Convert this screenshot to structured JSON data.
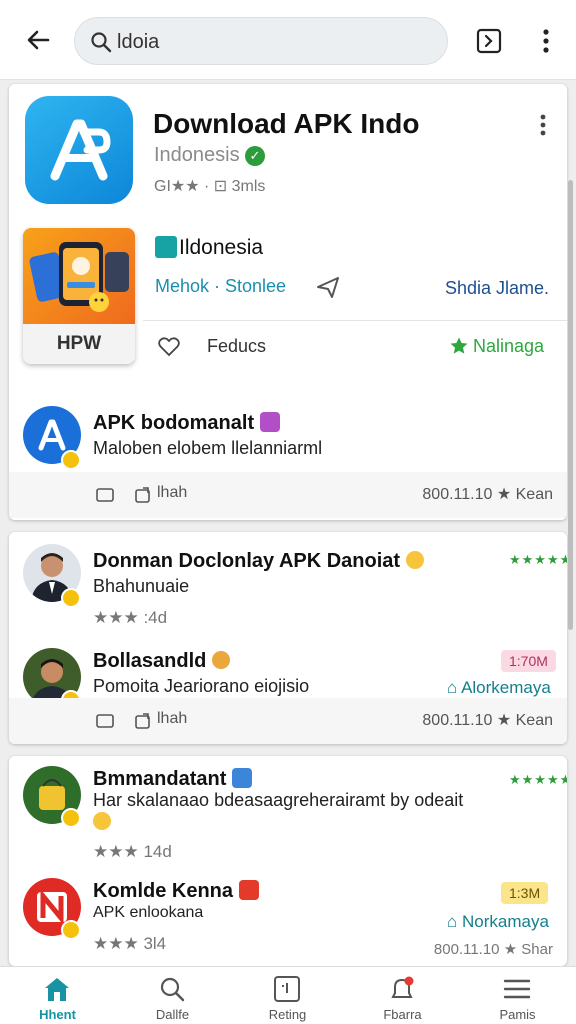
{
  "search": {
    "query": "ldoia"
  },
  "app": {
    "title": "Download APK Indo",
    "region": "Indonesis",
    "meta": "GI★★ · ⊡ 3mls"
  },
  "featured": {
    "tile_label": "HPW",
    "country": "Ildonesia",
    "links": "Mehok · Stonlee",
    "right_text": "Shdia Jlame.",
    "action_label": "Feducs",
    "star_label": "Nalinaga"
  },
  "posts": [
    {
      "title": "APK bodomanalt",
      "subtitle": "Maloben elobem llelanniarml",
      "footer_left": "lhah",
      "footer_right": "800.11.10 ★ Kean"
    },
    {
      "title": "Donman Doclonlay APK Danoiat",
      "subtitle": "Bhahunuaie",
      "stars_text": "★★★ :4d",
      "rating": "★★★★★"
    },
    {
      "title": "Bollasandld",
      "subtitle": "Pomoita Jeariorano eiojisio",
      "chip": "1:70M",
      "link": "Alorkemaya",
      "footer_left": "lhah",
      "footer_right": "800.11.10 ★ Kean"
    },
    {
      "title": "Bmmandatant",
      "subtitle": "Har skalanaao bdeasaagreherairamt by odeait",
      "stars_text": "★★★ 14d",
      "rating": "★★★★★"
    },
    {
      "title": "Komlde Kenna",
      "subtitle": "APK enlookana",
      "stars_text": "★★★ 3l4",
      "chip": "1:3M",
      "link": "Norkamaya",
      "footer_right": "800.11.10 ★ Shar"
    }
  ],
  "nav": [
    {
      "label": "Hhent",
      "icon": "home-icon",
      "active": true
    },
    {
      "label": "Dallfe",
      "icon": "search-icon",
      "active": false
    },
    {
      "label": "Reting",
      "icon": "box-icon",
      "active": false
    },
    {
      "label": "Fbarra",
      "icon": "bell-icon",
      "active": false
    },
    {
      "label": "Pamis",
      "icon": "menu-icon",
      "active": false
    }
  ],
  "colors": {
    "accent": "#1793a3",
    "app_icon": "#1a9ae6",
    "green": "#2e9c3c",
    "link_blue": "#1d4f91"
  }
}
